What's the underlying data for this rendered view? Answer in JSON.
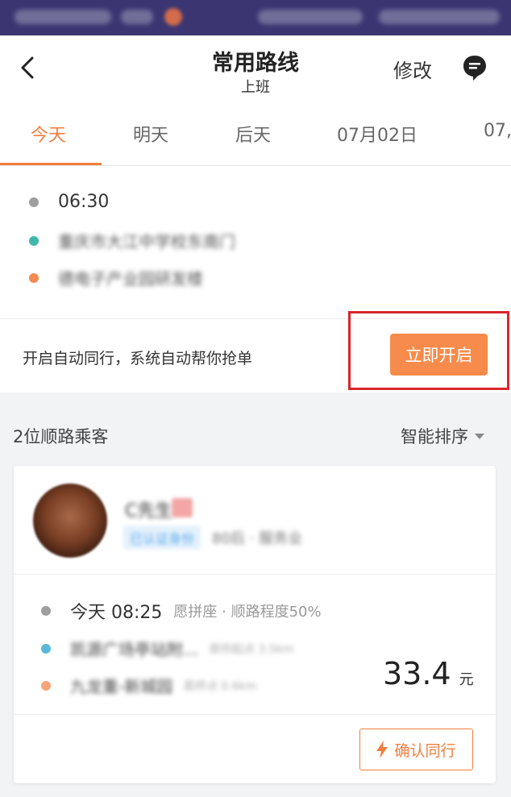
{
  "header": {
    "title": "常用路线",
    "subtitle": "上班",
    "edit_label": "修改"
  },
  "tabs": [
    {
      "label": "今天",
      "active": true
    },
    {
      "label": "明天",
      "active": false
    },
    {
      "label": "后天",
      "active": false
    },
    {
      "label": "07月02日",
      "active": false
    },
    {
      "label": "07,",
      "active": false
    }
  ],
  "route": {
    "time": "06:30",
    "start": "重庆市大江中学校东南门",
    "end": "德电子产业园研发楼",
    "colors": {
      "time": "#9e9e9e",
      "start": "#3fb8a9",
      "end": "#f28a52"
    }
  },
  "auto": {
    "text": "开启自动同行，系统自动帮你抢单",
    "button": "立即开启"
  },
  "section": {
    "title": "2位顺路乘客",
    "sort": "智能排序"
  },
  "passenger": {
    "name": "C先生",
    "tag": "已认证身份",
    "meta": "80后 · 服务业",
    "trip_time": "今天 08:25",
    "trip_desc": "愿拼座 · 顺路程度50%",
    "start": "凯源广场亭站附...",
    "start_dist": "距你起点 3.5km",
    "end": "九龙重-新城园",
    "end_dist": "距终点 0.6km",
    "price": "33.4",
    "price_unit": "元",
    "confirm": "确认同行"
  },
  "colors": {
    "accent": "#f27e3f",
    "button_bg": "#f78b4b",
    "status_bar": "#3b3672",
    "highlight_box": "#d8262b"
  }
}
